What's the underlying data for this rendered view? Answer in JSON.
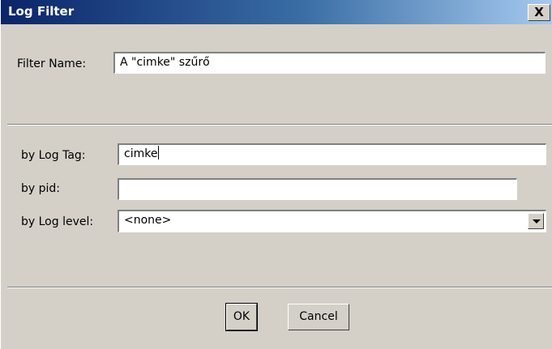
{
  "window": {
    "title": "Log Filter",
    "close_glyph": "X"
  },
  "form": {
    "filter_name_label": "Filter Name:",
    "filter_name_value": "A \"cimke\" szűrő",
    "log_tag_label": "by Log Tag:",
    "log_tag_value": "cimke",
    "pid_label": "by pid:",
    "pid_value": "",
    "log_level_label": "by Log level:",
    "log_level_value": "<none>"
  },
  "buttons": {
    "ok_label": "OK",
    "cancel_label": "Cancel"
  },
  "colors": {
    "titlebar_start": "#0a246a",
    "titlebar_end": "#a6caf0",
    "dialog_bg": "#d4d0c8"
  }
}
